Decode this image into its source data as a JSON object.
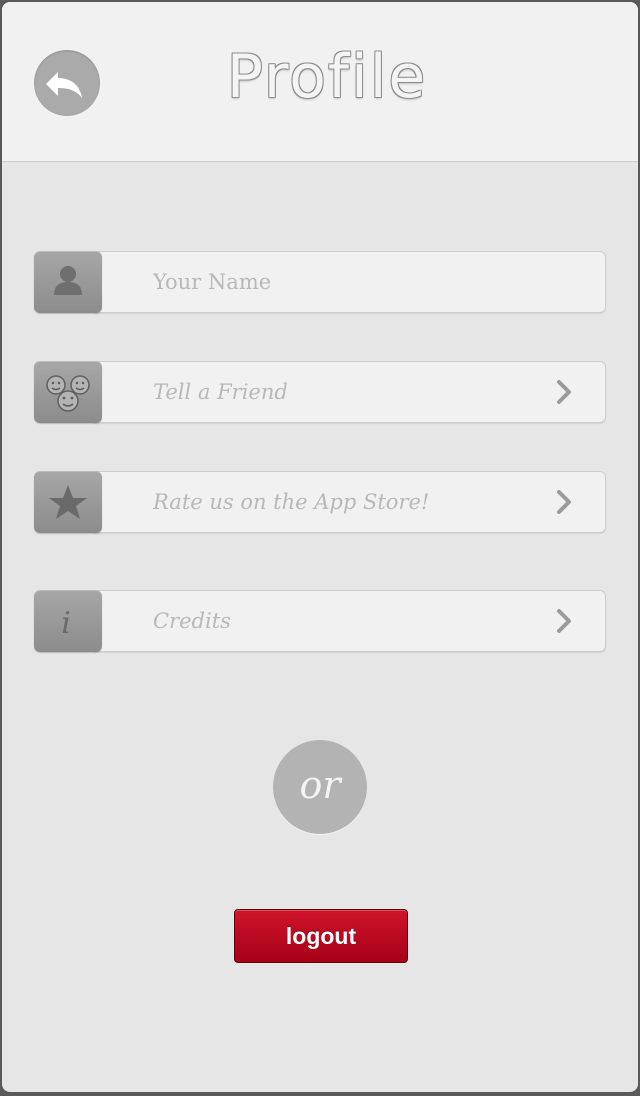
{
  "header": {
    "title": "Profile",
    "back_icon": "back-arrow-icon"
  },
  "rows": [
    {
      "id": "name",
      "icon": "person-icon",
      "placeholder": "Your Name",
      "has_chevron": false
    },
    {
      "id": "tell-friend",
      "icon": "friends-icon",
      "label": "Tell a Friend",
      "has_chevron": true
    },
    {
      "id": "rate",
      "icon": "star-icon",
      "label": "Rate us on the App Store!",
      "has_chevron": true
    },
    {
      "id": "credits",
      "icon": "info-icon",
      "label": "Credits",
      "has_chevron": true
    }
  ],
  "separator": {
    "text": "or"
  },
  "logout": {
    "label": "logout"
  },
  "colors": {
    "background": "#e6e6e6",
    "header": "#f1f1f1",
    "icon_tile": "#999999",
    "logout_red": "#c00d23"
  }
}
